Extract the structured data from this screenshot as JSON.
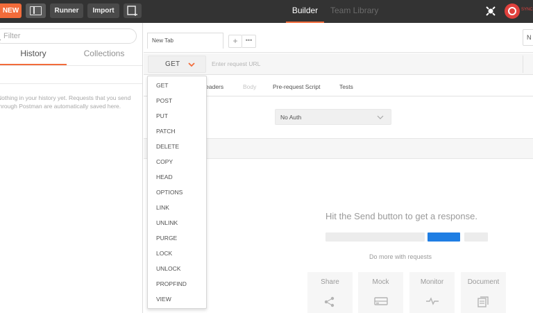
{
  "topbar": {
    "new_label": "NEW",
    "runner_label": "Runner",
    "import_label": "Import",
    "builder_label": "Builder",
    "team_library_label": "Team Library",
    "sync_label": "SYNC"
  },
  "sidebar": {
    "filter_placeholder": "Filter",
    "tabs": [
      {
        "label": "History",
        "active": true
      },
      {
        "label": "Collections",
        "active": false
      }
    ],
    "empty_message": "Nothing in your history yet. Requests that you send through Postman are automatically saved here."
  },
  "request_tabs": {
    "active_tab": "New Tab",
    "add_symbol": "+",
    "more_symbol": "•••",
    "environment_initial": "N"
  },
  "request": {
    "method": "GET",
    "url_placeholder": "Enter request URL",
    "subtabs": [
      {
        "label": "Headers",
        "dim": false
      },
      {
        "label": "Body",
        "dim": true
      },
      {
        "label": "Pre-request Script",
        "dim": false
      },
      {
        "label": "Tests",
        "dim": false
      }
    ],
    "auth_type": "No Auth"
  },
  "method_menu": {
    "items": [
      "GET",
      "POST",
      "PUT",
      "PATCH",
      "DELETE",
      "COPY",
      "HEAD",
      "OPTIONS",
      "LINK",
      "UNLINK",
      "PURGE",
      "LOCK",
      "UNLOCK",
      "PROPFIND",
      "VIEW"
    ]
  },
  "response": {
    "empty_title": "Hit the Send button to get a response.",
    "do_more_label": "Do more with requests",
    "cards": [
      {
        "label": "Share",
        "icon": "share-icon"
      },
      {
        "label": "Mock",
        "icon": "mock-server-icon"
      },
      {
        "label": "Monitor",
        "icon": "monitor-pulse-icon"
      },
      {
        "label": "Document",
        "icon": "document-icon"
      }
    ]
  },
  "colors": {
    "accent_orange": "#f26b3a",
    "topbar_bg": "#333333",
    "send_blue": "#1f7ee3",
    "sync_red": "#e0413d"
  }
}
